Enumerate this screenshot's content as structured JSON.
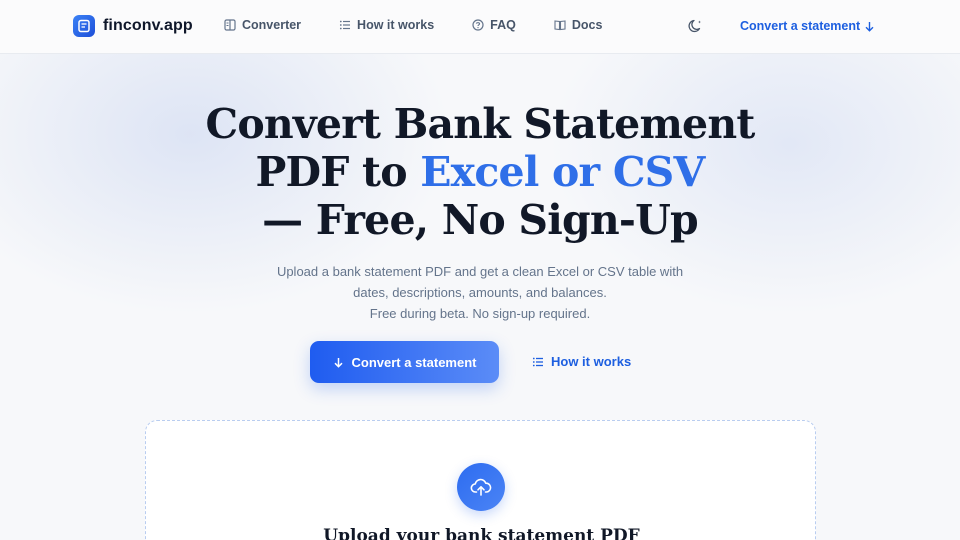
{
  "header": {
    "logo_text": "finconv.app",
    "nav": [
      {
        "label": "Converter",
        "icon": "converter-icon"
      },
      {
        "label": "How it works",
        "icon": "list-icon"
      },
      {
        "label": "FAQ",
        "icon": "help-circle-icon"
      },
      {
        "label": "Docs",
        "icon": "book-icon"
      }
    ],
    "theme_toggle_icon": "moon-icon",
    "cta_label": "Convert a statement",
    "cta_icon": "arrow-down-icon"
  },
  "hero": {
    "title_line1": "Convert Bank Statement",
    "title_line2_prefix": "PDF to ",
    "title_line2_accent": "Excel or CSV",
    "title_line3": "— Free, No Sign-Up",
    "subtitle_line1": "Upload a bank statement PDF and get a clean Excel or CSV table with",
    "subtitle_line2": "dates, descriptions, amounts, and balances.",
    "subtitle_line3": "Free during beta. No sign-up required.",
    "primary_button": "Convert a statement",
    "secondary_button": "How it works"
  },
  "upload": {
    "title": "Upload your bank statement PDF",
    "icon": "cloud-upload-icon"
  },
  "colors": {
    "accent": "#2f6fe8",
    "link": "#1d5fe0",
    "title": "#111827",
    "muted": "#64748b"
  }
}
